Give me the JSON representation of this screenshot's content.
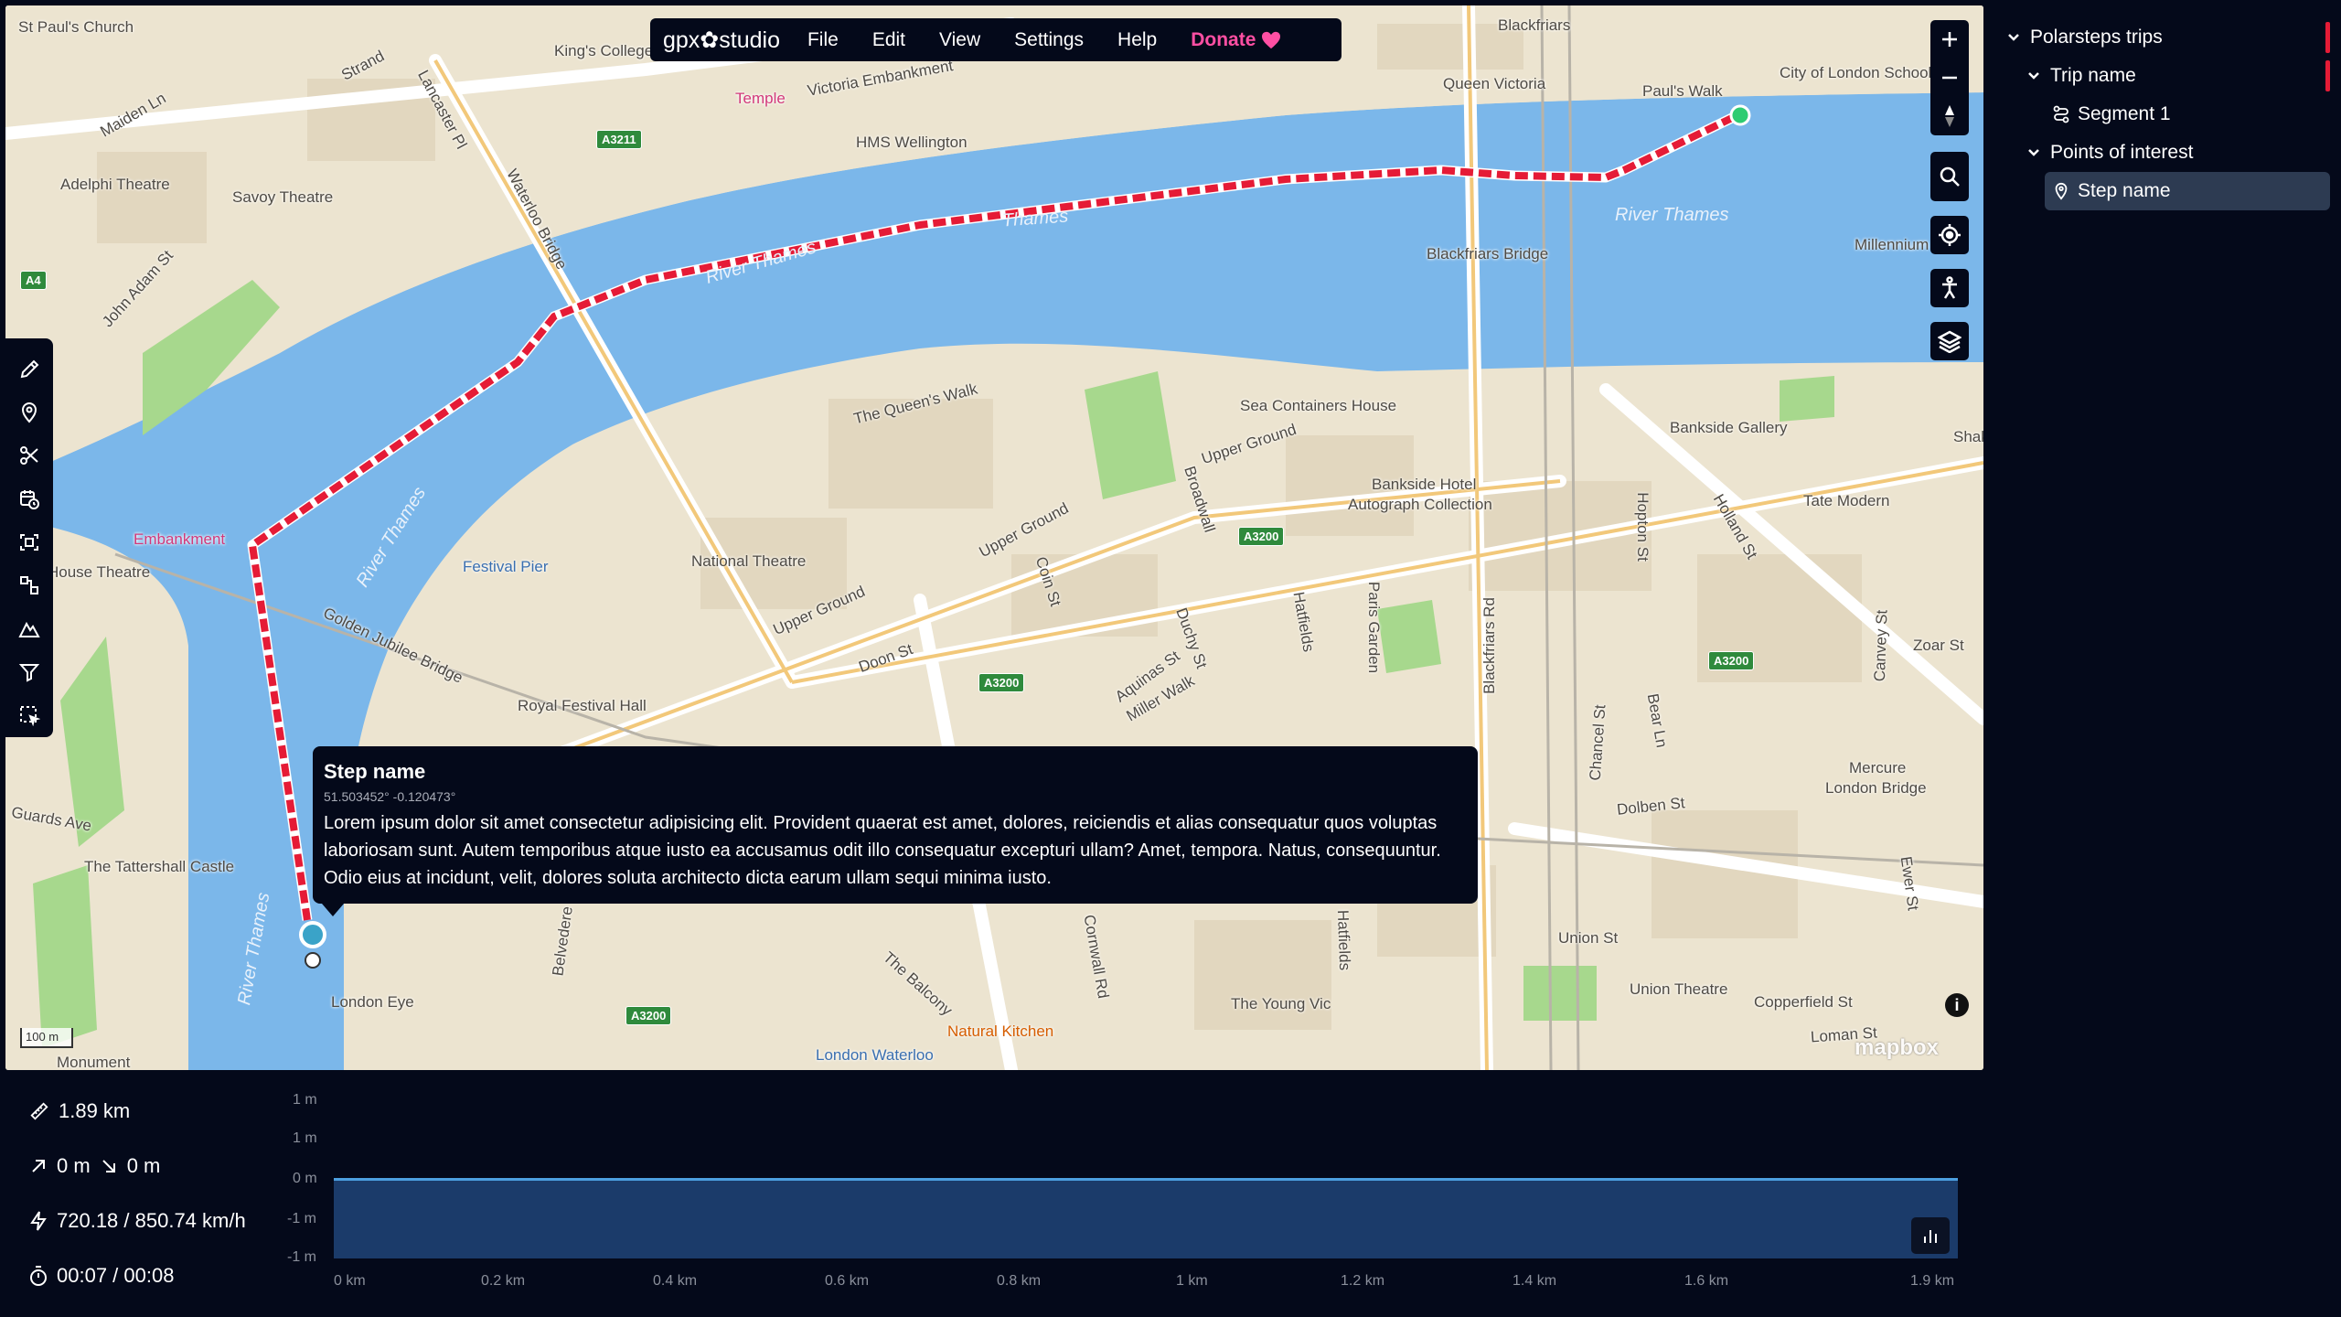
{
  "menubar": {
    "logo": "gpx✿studio",
    "items": [
      "File",
      "Edit",
      "View",
      "Settings",
      "Help"
    ],
    "donate": "Donate"
  },
  "map": {
    "labels": [
      {
        "text": "St Paul's Church"
      },
      {
        "text": "Strand"
      },
      {
        "text": "Lancaster Pl"
      },
      {
        "text": "King's College"
      },
      {
        "text": "Maiden Ln"
      },
      {
        "text": "Adelphi Theatre"
      },
      {
        "text": "Savoy Theatre"
      },
      {
        "text": "John Adam St"
      },
      {
        "text": "Temple"
      },
      {
        "text": "Victoria Embankment"
      },
      {
        "text": "HMS Wellington"
      },
      {
        "text": "Thames"
      },
      {
        "text": "River Thames"
      },
      {
        "text": "Blackfriars"
      },
      {
        "text": "Queen Victoria"
      },
      {
        "text": "Paul's Walk"
      },
      {
        "text": "City of London School"
      },
      {
        "text": "River Thames"
      },
      {
        "text": "Blackfriars Bridge"
      },
      {
        "text": "Millennium"
      },
      {
        "text": "Waterloo Bridge"
      },
      {
        "text": "Sea Containers House"
      },
      {
        "text": "Upper Ground"
      },
      {
        "text": "Bankside Gallery"
      },
      {
        "text": "The Queen's Walk"
      },
      {
        "text": "Bankside Hotel"
      },
      {
        "text": "Autograph Collection"
      },
      {
        "text": "Tate Modern"
      },
      {
        "text": "Embankment"
      },
      {
        "text": "National Theatre"
      },
      {
        "text": "Upper Ground"
      },
      {
        "text": "Festival Pier"
      },
      {
        "text": "River Thames"
      },
      {
        "text": "House Theatre"
      },
      {
        "text": "Golden Jubilee Bridge"
      },
      {
        "text": "Upper Ground"
      },
      {
        "text": "Doon St"
      },
      {
        "text": "Royal Festival Hall"
      },
      {
        "text": "Coin St"
      },
      {
        "text": "Broadwall"
      },
      {
        "text": "Hatfields"
      },
      {
        "text": "Paris Garden"
      },
      {
        "text": "Blackfriars Rd"
      },
      {
        "text": "Hopton St"
      },
      {
        "text": "Holland St"
      },
      {
        "text": "Aquinas St"
      },
      {
        "text": "Duchy St"
      },
      {
        "text": "Miller Walk"
      },
      {
        "text": "Zoar St"
      },
      {
        "text": "Mercure"
      },
      {
        "text": "London Bridge"
      },
      {
        "text": "Dolben St"
      },
      {
        "text": "Bear Ln"
      },
      {
        "text": "Chancel St"
      },
      {
        "text": "Canvey St"
      },
      {
        "text": "Guards Ave"
      },
      {
        "text": "The Tattershall Castle"
      },
      {
        "text": "River Thames"
      },
      {
        "text": "London Eye"
      },
      {
        "text": "Belvedere Rd"
      },
      {
        "text": "The Balcony"
      },
      {
        "text": "Natural Kitchen"
      },
      {
        "text": "London Waterloo"
      },
      {
        "text": "Cornwall Rd"
      },
      {
        "text": "Hatfields"
      },
      {
        "text": "The Young Vic"
      },
      {
        "text": "Union St"
      },
      {
        "text": "Union Theatre"
      },
      {
        "text": "Copperfield St"
      },
      {
        "text": "Loman St"
      },
      {
        "text": "Monument"
      },
      {
        "text": "Ewer St"
      },
      {
        "text": "Shak"
      }
    ],
    "road_badges": [
      {
        "text": "A3211"
      },
      {
        "text": "A4"
      },
      {
        "text": "A3200"
      },
      {
        "text": "A3200"
      },
      {
        "text": "A3200"
      },
      {
        "text": "A3200"
      }
    ],
    "scale": "100 m",
    "attribution": "mapbox",
    "colors": {
      "water": "#7bb7ea",
      "land": "#ece4d0",
      "park": "#a7d88d",
      "track": "#e51b36"
    }
  },
  "controls": {
    "zoom_in": "zoom-in",
    "zoom_out": "zoom-out",
    "compass": "compass"
  },
  "popup": {
    "title": "Step name",
    "coords": "51.503452° -0.120473°",
    "description": "Lorem ipsum dolor sit amet consectetur adipisicing elit. Provident quaerat est amet, dolores, reiciendis et alias consequatur quos voluptas laboriosam sunt. Autem temporibus atque iusto ea accusamus odit illo consequatur excepturi ullam? Amet, tempora. Natus, consequuntur. Odio eius at incidunt, velit, dolores soluta architecto dicta earum ullam sequi minima iusto."
  },
  "tree": {
    "root": "Polarsteps trips",
    "trip": "Trip name",
    "segment": "Segment 1",
    "poi_group": "Points of interest",
    "poi": "Step name"
  },
  "stats": {
    "distance": "1.89 km",
    "elevation": "0 m",
    "descent": "0 m",
    "speed": "720.18 / 850.74 km/h",
    "time": "00:07 / 00:08"
  },
  "elevation_chart": {
    "y_ticks": [
      "1 m",
      "1 m",
      "0 m",
      "-1 m",
      "-1 m"
    ],
    "x_ticks": [
      "0 km",
      "0.2 km",
      "0.4 km",
      "0.6 km",
      "0.8 km",
      "1 km",
      "1.2 km",
      "1.4 km",
      "1.6 km",
      "1.9 km"
    ]
  }
}
